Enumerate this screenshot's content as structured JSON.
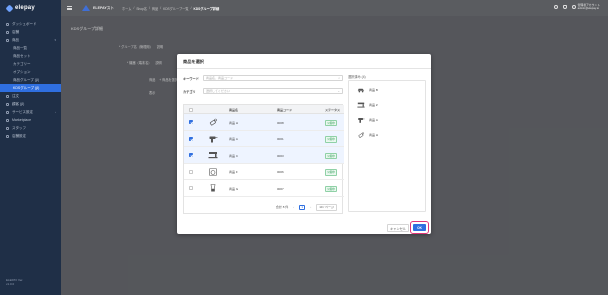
{
  "app": {
    "brand": "elepay"
  },
  "header": {
    "store_name": "ELEPAYスト",
    "breadcrumbs": [
      "ホーム",
      "Shop名",
      "商品",
      "KDSグループ一覧"
    ],
    "current_crumb": "KDSグループ詳細",
    "user_name": "管理者アカウント",
    "user_sub": "admin@elepay.io"
  },
  "sidebar": {
    "items": [
      {
        "label": "ダッシュボード",
        "level": 0
      },
      {
        "label": "店舗",
        "level": 0
      },
      {
        "label": "商品",
        "level": 0,
        "chevron": "▾"
      },
      {
        "label": "商品一覧",
        "level": 1
      },
      {
        "label": "商品セット",
        "level": 1
      },
      {
        "label": "カテゴリー",
        "level": 1
      },
      {
        "label": "オプション",
        "level": 1
      },
      {
        "label": "商品グループ (β)",
        "level": 1
      },
      {
        "label": "KDSグループ (β)",
        "level": 1,
        "active": true
      },
      {
        "label": "注文",
        "level": 0
      },
      {
        "label": "顧客 (β)",
        "level": 0
      },
      {
        "label": "サービス設定",
        "level": 0,
        "chevron": "›"
      },
      {
        "label": "Marketplace",
        "level": 0
      },
      {
        "label": "スタッフ",
        "level": 0
      },
      {
        "label": "店舗設定",
        "level": 0
      }
    ],
    "footer_line1": "ELEPAY Ver.",
    "footer_line2": "v1.0.0"
  },
  "page": {
    "title": "KDSグループ詳細",
    "rows": [
      {
        "label": "* グループ名（管理用）",
        "value": "説明"
      },
      {
        "label": "* 機器（端末名）",
        "value": "説明"
      },
      {
        "label": "商品",
        "value": "+ 商品を選択"
      },
      {
        "label": "表示",
        "value": ""
      }
    ]
  },
  "modal": {
    "title": "商品を選択",
    "keyword_label": "キーワード",
    "keyword_placeholder": "商品名、商品コード",
    "category_label": "カテゴリ",
    "category_placeholder": "選択してください",
    "table": {
      "columns": [
        "商品名",
        "商品コード",
        "ステータス"
      ],
      "rows": [
        {
          "name": "商品 H",
          "code": "0008",
          "status": "公開中",
          "checked": true,
          "thumb": "paint-tube"
        },
        {
          "name": "商品 A",
          "code": "0001",
          "status": "公開中",
          "checked": true,
          "thumb": "drill"
        },
        {
          "name": "商品 C",
          "code": "0003",
          "status": "公開中",
          "checked": true,
          "thumb": "sewing-machine"
        },
        {
          "name": "商品 F",
          "code": "0006",
          "status": "公開中",
          "checked": false,
          "thumb": "washing-machine"
        },
        {
          "name": "商品 G",
          "code": "0007",
          "status": "公開中",
          "checked": false,
          "thumb": "blender"
        }
      ]
    },
    "pager": {
      "total": "合計 8 件",
      "prev": "‹",
      "page": "1",
      "next": "›",
      "size": "10 / ページ"
    },
    "selected": {
      "title": "選択済み (4)",
      "items": [
        {
          "name": "商品 B",
          "thumb": "car"
        },
        {
          "name": "商品 Z",
          "thumb": "sewing-machine"
        },
        {
          "name": "商品 A",
          "thumb": "drill"
        },
        {
          "name": "商品 H",
          "thumb": "paint-tube"
        }
      ]
    },
    "cancel_label": "キャンセル",
    "ok_label": "OK"
  },
  "colors": {
    "sidebar_bg": "#1f2f47",
    "accent": "#2f6fe0",
    "status_green": "#2c9a55",
    "highlight_ring": "#e0357a"
  }
}
